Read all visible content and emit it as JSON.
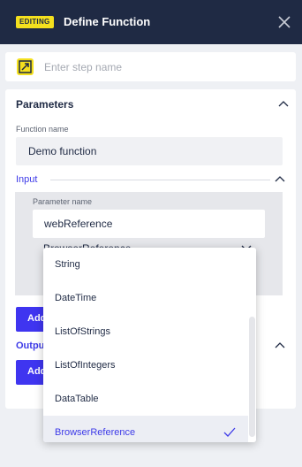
{
  "header": {
    "badge": "EDITING",
    "title": "Define Function"
  },
  "step": {
    "placeholder": "Enter step name",
    "value": ""
  },
  "parameters": {
    "title": "Parameters",
    "function_name_label": "Function name",
    "function_name_value": "Demo function"
  },
  "input": {
    "title": "Input",
    "parameter_name_label": "Parameter name",
    "parameter_name_value": "webReference",
    "selected_type": "BrowserReference",
    "add_button": "Add"
  },
  "output": {
    "title": "Output",
    "add_button": "Add"
  },
  "type_options": [
    "String",
    "DateTime",
    "ListOfStrings",
    "ListOfIntegers",
    "DataTable",
    "BrowserReference"
  ],
  "colors": {
    "header_bg": "#1f2a44",
    "badge_bg": "#f4e01e",
    "accent": "#3f35f0",
    "link": "#3d3ae8"
  }
}
